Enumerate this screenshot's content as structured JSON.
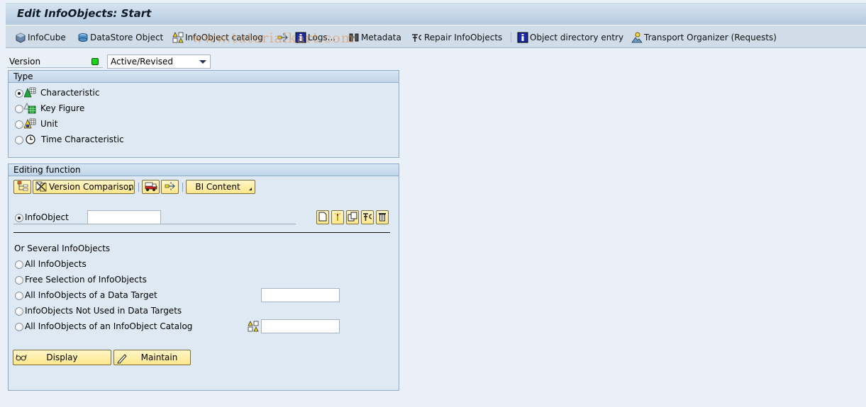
{
  "window": {
    "title": "Edit InfoObjects: Start"
  },
  "watermark": "www.tutorialkart.com",
  "toolbar": {
    "items": [
      {
        "label": "InfoCube",
        "icon": "infocube-icon"
      },
      {
        "label": "DataStore Object",
        "icon": "datastore-icon"
      },
      {
        "label": "InfoObject catalog",
        "icon": "infoobject-catalog-icon"
      },
      {
        "label": "",
        "icon": "transfer-icon"
      },
      {
        "label": "Logs...",
        "icon": "info-icon"
      },
      {
        "label": "Metadata",
        "icon": "binoculars-icon"
      },
      {
        "label": "Repair InfoObjects",
        "icon": "repair-icon"
      },
      {
        "label": "Object directory entry",
        "icon": "info-icon"
      },
      {
        "label": "Transport Organizer (Requests)",
        "icon": "transport-organizer-icon"
      }
    ]
  },
  "version": {
    "label": "Version",
    "status_color": "#19d219",
    "selected": "Active/Revised"
  },
  "type_group": {
    "title": "Type",
    "options": [
      {
        "label": "Characteristic",
        "checked": true,
        "icon": "characteristic-icon"
      },
      {
        "label": "Key Figure",
        "checked": false,
        "icon": "key-figure-icon"
      },
      {
        "label": "Unit",
        "checked": false,
        "icon": "unit-icon"
      },
      {
        "label": "Time Characteristic",
        "checked": false,
        "icon": "clock-icon"
      }
    ]
  },
  "editing_group": {
    "title": "Editing function",
    "toolbar": {
      "version_comparison": "Version Comparison",
      "bi_content": "BI Content"
    },
    "infoobject": {
      "label": "InfoObject",
      "value": "",
      "checked": true
    },
    "several_heading": "Or Several InfoObjects",
    "options": [
      {
        "label": "All InfoObjects"
      },
      {
        "label": "Free Selection of InfoObjects"
      },
      {
        "label": "All InfoObjects of a Data Target",
        "value": ""
      },
      {
        "label": "InfoObjects Not Used in Data Targets"
      },
      {
        "label": "All InfoObjects of an InfoObject Catalog",
        "value": ""
      }
    ],
    "buttons": {
      "display": "Display",
      "maintain": "Maintain"
    }
  }
}
